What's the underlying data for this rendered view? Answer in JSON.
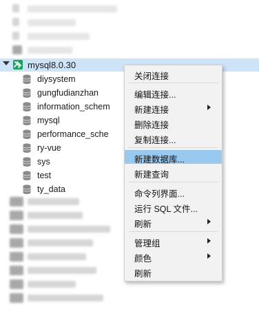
{
  "connection": {
    "label": "mysql8.0.30",
    "icon": "connection-plug-icon",
    "accent": "#1aa260"
  },
  "databases": [
    {
      "label": "diysystem"
    },
    {
      "label": "gungfudianzhan"
    },
    {
      "label": "information_schem"
    },
    {
      "label": "mysql"
    },
    {
      "label": "performance_sche"
    },
    {
      "label": "ry-vue"
    },
    {
      "label": "sys"
    },
    {
      "label": "test"
    },
    {
      "label": "ty_data"
    }
  ],
  "menu": {
    "items": [
      {
        "label": "关闭连接"
      },
      {
        "label": "编辑连接..."
      },
      {
        "label": "新建连接"
      },
      {
        "label": "删除连接"
      },
      {
        "label": "复制连接..."
      },
      {
        "label": "新建数据库..."
      },
      {
        "label": "新建查询"
      },
      {
        "label": "命令列界面..."
      },
      {
        "label": "运行 SQL 文件..."
      },
      {
        "label": "刷新"
      },
      {
        "label": "管理组"
      },
      {
        "label": "颜色"
      },
      {
        "label": "刷新"
      }
    ],
    "highlight_color": "#99c9ef"
  },
  "colors": {
    "selection": "#cce3f8",
    "menu_bg": "#f2f2f2"
  }
}
